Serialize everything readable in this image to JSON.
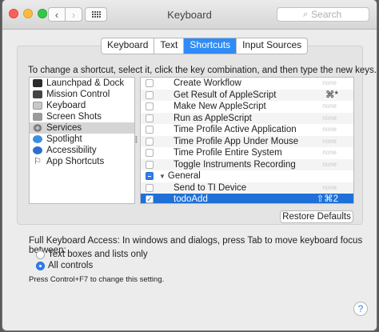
{
  "window": {
    "title": "Keyboard",
    "search_placeholder": "Search",
    "nav_back_glyph": "‹",
    "nav_forward_glyph": "›"
  },
  "tabs": [
    {
      "label": "Keyboard",
      "active": false
    },
    {
      "label": "Text",
      "active": false
    },
    {
      "label": "Shortcuts",
      "active": true
    },
    {
      "label": "Input Sources",
      "active": false
    }
  ],
  "instructions": "To change a shortcut, select it, click the key combination, and then type the new keys.",
  "categories": [
    {
      "label": "Launchpad & Dock",
      "icon": "launchpad-icon"
    },
    {
      "label": "Mission Control",
      "icon": "mission-control-icon"
    },
    {
      "label": "Keyboard",
      "icon": "keyboard-icon"
    },
    {
      "label": "Screen Shots",
      "icon": "screenshot-icon"
    },
    {
      "label": "Services",
      "icon": "gear-icon",
      "selected": true
    },
    {
      "label": "Spotlight",
      "icon": "spotlight-icon"
    },
    {
      "label": "Accessibility",
      "icon": "accessibility-icon"
    },
    {
      "label": "App Shortcuts",
      "icon": "app-shortcuts-icon"
    }
  ],
  "shortcuts": [
    {
      "name": "Create Workflow",
      "key": "none"
    },
    {
      "name": "Get Result of AppleScript",
      "key": "⌘*"
    },
    {
      "name": "Make New AppleScript",
      "key": "none"
    },
    {
      "name": "Run as AppleScript",
      "key": "none"
    },
    {
      "name": "Time Profile Active Application",
      "key": "none"
    },
    {
      "name": "Time Profile App Under Mouse",
      "key": "none"
    },
    {
      "name": "Time Profile Entire System",
      "key": "none"
    },
    {
      "name": "Toggle Instruments Recording",
      "key": "none"
    },
    {
      "group": "General"
    },
    {
      "name": "Send to TI Device",
      "key": "none"
    },
    {
      "name": "todoAdd",
      "key": "⇧⌘2",
      "selected": true
    }
  ],
  "restore_defaults_label": "Restore Defaults",
  "full_keyboard_access": {
    "title": "Full Keyboard Access: In windows and dialogs, press Tab to move keyboard focus between:",
    "options": [
      "Text boxes and lists only",
      "All controls"
    ],
    "selected": "All controls",
    "hint": "Press Control+F7 to change this setting."
  },
  "help_glyph": "?",
  "colors": {
    "accent": "#2f8cf7",
    "selection": "#1f70d9"
  }
}
